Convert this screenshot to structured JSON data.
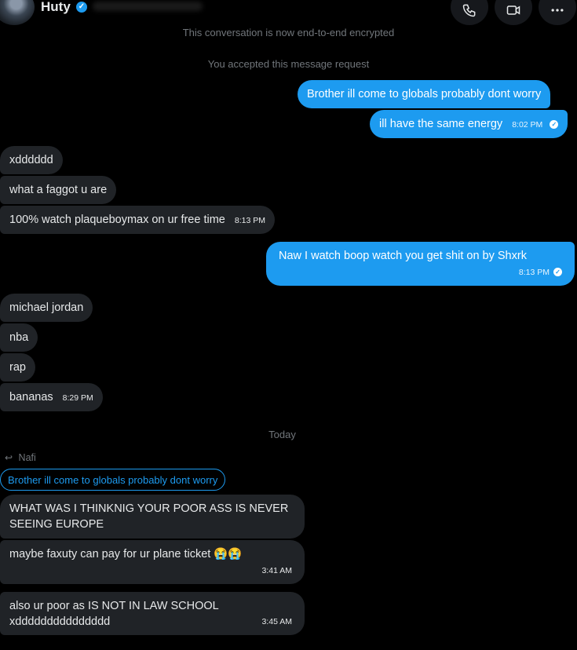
{
  "header": {
    "name": "Huty"
  },
  "notes": {
    "encrypted": "This conversation is now end-to-end encrypted",
    "accepted": "You accepted this message request",
    "today": "Today"
  },
  "messages": {
    "m1": {
      "text": "Brother ill come to globals probably dont worry"
    },
    "m2": {
      "text": "ill have the same energy",
      "time": "8:02 PM"
    },
    "m3": {
      "text": "xdddddd"
    },
    "m4": {
      "text": "what a faggot u are"
    },
    "m5": {
      "text": "100% watch plaqueboymax on ur free time",
      "time": "8:13 PM"
    },
    "m6": {
      "text": "Naw I watch boop watch you get shit on by Shxrk",
      "time": "8:13 PM"
    },
    "m7": {
      "text": "michael jordan"
    },
    "m8": {
      "text": "nba"
    },
    "m9": {
      "text": "rap"
    },
    "m10": {
      "text": "bananas",
      "time": "8:29 PM"
    },
    "reply": {
      "label": "Nafi",
      "quote": "Brother ill come to globals probably dont worry"
    },
    "m11": {
      "text": "WHAT WAS I THINKNIG YOUR POOR ASS IS NEVER SEEING EUROPE"
    },
    "m12": {
      "text": "maybe faxuty can pay for ur plane ticket 😭😭",
      "time": "3:41 AM"
    },
    "m13": {
      "text": "also ur poor as IS NOT IN LAW SCHOOL xddddddddddddddd",
      "time": "3:45 AM"
    }
  },
  "icons": {
    "phone": "phone-icon",
    "video": "video-icon",
    "more": "more-icon",
    "verified": "verified-badge-icon",
    "reply": "reply-arrow-icon",
    "read": "read-check-icon"
  },
  "colors": {
    "accent": "#1d9bf0",
    "incoming": "#202327",
    "background": "#000000"
  }
}
